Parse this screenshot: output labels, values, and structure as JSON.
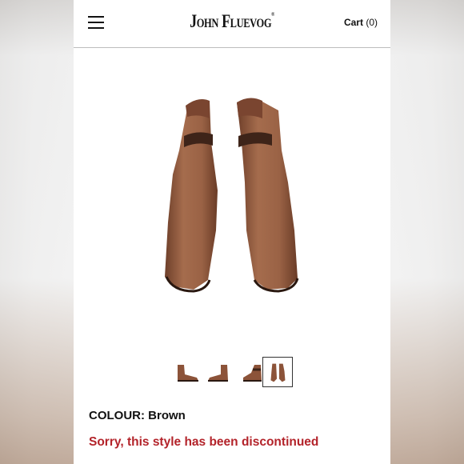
{
  "header": {
    "logo_text": "John Fluevog",
    "logo_mark": "®",
    "cart_label": "Cart",
    "cart_count": "(0)"
  },
  "icons": {
    "menu": "hamburger-menu-icon"
  },
  "product": {
    "colour_label": "COLOUR:",
    "colour_value": "Brown",
    "status_message": "Sorry, this style has been discontinued",
    "selected_thumbnail_index": 3,
    "thumbnail_count": 4
  },
  "colors": {
    "status": "#b3232a",
    "leather": "#9a6245",
    "text": "#111111"
  }
}
